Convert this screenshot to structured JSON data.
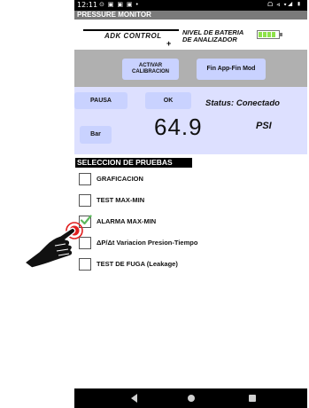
{
  "status_bar": {
    "time": "12:11",
    "left_icons": "⊙ ▣ ▣ ▣ •",
    "right_icons": "ᗝ ⊲ ▾◢ ▮"
  },
  "app": {
    "title": "PRESSURE MONITOR",
    "logo_text": "ADK CONTROL",
    "battery_label_line1": "NIVEL DE BATERIA",
    "battery_label_line2": "DE ANALIZADOR",
    "battery_level": 0.85
  },
  "toolbar": {
    "calibrate_line1": "ACTIVAR",
    "calibrate_line2": "CALIBRACION",
    "fin_mode": "Fin App-Fin Mod"
  },
  "monitor": {
    "pause_label": "PAUSA",
    "ok_label": "OK",
    "status": "Status: Conectado",
    "bar_label": "Bar",
    "reading": "64.9",
    "unit": "PSI"
  },
  "tests": {
    "title": "SELECCION DE PRUEBAS",
    "items": [
      {
        "label": "GRAFICACION",
        "checked": false
      },
      {
        "label": "TEST MAX-MIN",
        "checked": false
      },
      {
        "label": "ALARMA MAX-MIN",
        "checked": true
      },
      {
        "label": "ΔP/Δt Variacion Presion-Tiempo",
        "checked": false
      },
      {
        "label": "TEST DE FUGA (Leakage)",
        "checked": false
      }
    ]
  },
  "colors": {
    "button_fill": "#c9d2ff",
    "panel_blue": "#dde0ff",
    "panel_grey": "#b0b0b0",
    "title_bar": "#7a7a7a",
    "check_green": "#5cb85c",
    "touch_red": "#e02020"
  },
  "icons": [
    "battery-icon",
    "check-icon",
    "hand-pointer-icon",
    "nav-back-icon",
    "nav-home-icon",
    "nav-recent-icon"
  ]
}
